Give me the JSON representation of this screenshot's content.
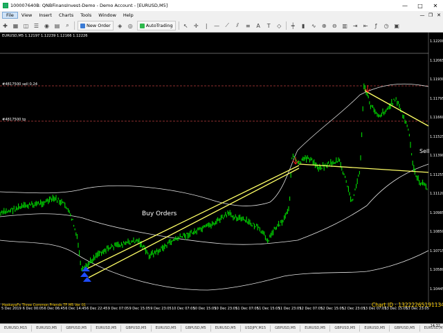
{
  "window": {
    "title": "100007640B: QNBFinansInvest-Demo - Demo Account - [EURUSD,M5]",
    "controls": [
      "—",
      "□",
      "✕"
    ]
  },
  "menu": {
    "items": [
      "File",
      "View",
      "Insert",
      "Charts",
      "Tools",
      "Window",
      "Help"
    ],
    "right_controls": [
      "—",
      "❐",
      "✕"
    ]
  },
  "toolbar": {
    "new_order_label": "New Order",
    "autotrading_label": "AutoTrading"
  },
  "chart": {
    "symbol_info": "EURUSD,M5  1.12197 1.12239 1.12166 1.12226",
    "order_lines": [
      {
        "label": "#4817500 sell 0.24",
        "price": 1.1188
      },
      {
        "label": "#4817500 tp",
        "price": 1.1174
      }
    ],
    "price_ticks": [
      "1.12200",
      "1.12065",
      "1.11930",
      "1.11795",
      "1.11660",
      "1.11525",
      "1.11390",
      "1.11255",
      "1.11120",
      "1.10985",
      "1.10850",
      "1.10715",
      "1.10580",
      "1.10445"
    ],
    "time_ticks": [
      "5 Dec 2019",
      "6 Dec 00:05",
      "6 Dec 06:45",
      "6 Dec 14:45",
      "6 Dec 22:45",
      "9 Dec 07:05",
      "9 Dec 15:05",
      "9 Dec 23:05",
      "10 Dec 07:05",
      "10 Dec 15:05",
      "10 Dec 23:05",
      "11 Dec 07:05",
      "11 Dec 15:05",
      "11 Dec 23:05",
      "12 Dec 07:05",
      "12 Dec 15:05",
      "12 Dec 23:05",
      "13 Dec 07:05",
      "13 Dec 15:05",
      "13 Dec 23:05"
    ],
    "buy_orders_text": "Buy Orders",
    "sell_text": "Sell",
    "indicator_text": "HaskayaFx Three Common Friends TF M5 Ver 01",
    "chart_id_text": "Chart ID : 132222651911342089",
    "colors": {
      "candles": "#00e000",
      "bands": "#ffffff",
      "trendlines": "#ffff66",
      "order_line": "#c04040",
      "sell_arrow": "#ff2020",
      "buy_arrow": "#1e4cff"
    }
  },
  "tabs": [
    "EURUSD,M15",
    "EURUSD,M5",
    "GBPUSD,M5",
    "EURUSD,M5",
    "GBPUSD,M5",
    "EURUSD,M5",
    "GBPUSD,M5",
    "EURUSD,M5",
    "USDJPY,M15",
    "GBPUSD,M5",
    "EURUSD,M5",
    "GBPUSD,M5",
    "EURUSD,M5",
    "GBPUSD,M5",
    "EURUSD,M5"
  ],
  "clock": "14:32"
}
